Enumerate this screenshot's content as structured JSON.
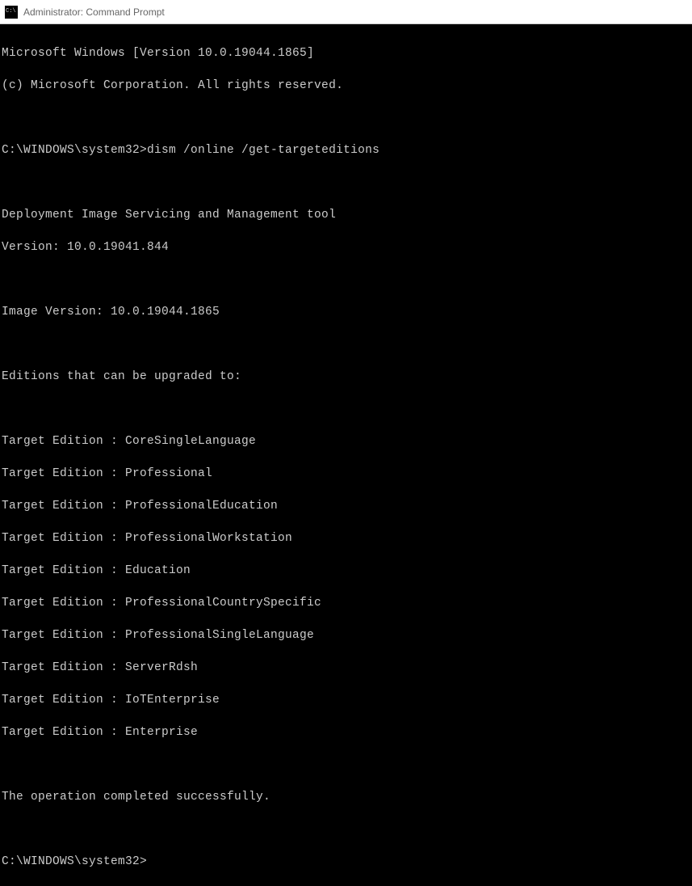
{
  "titlebar": {
    "text": "Administrator: Command Prompt"
  },
  "terminal": {
    "banner_line1": "Microsoft Windows [Version 10.0.19044.1865]",
    "banner_line2": "(c) Microsoft Corporation. All rights reserved.",
    "prompt1_path": "C:\\WINDOWS\\system32>",
    "prompt1_command": "dism /online /get-targeteditions",
    "tool_name": "Deployment Image Servicing and Management tool",
    "tool_version": "Version: 10.0.19041.844",
    "image_version": "Image Version: 10.0.19044.1865",
    "editions_header": "Editions that can be upgraded to:",
    "editions": [
      "Target Edition : CoreSingleLanguage",
      "Target Edition : Professional",
      "Target Edition : ProfessionalEducation",
      "Target Edition : ProfessionalWorkstation",
      "Target Edition : Education",
      "Target Edition : ProfessionalCountrySpecific",
      "Target Edition : ProfessionalSingleLanguage",
      "Target Edition : ServerRdsh",
      "Target Edition : IoTEnterprise",
      "Target Edition : Enterprise"
    ],
    "completion": "The operation completed successfully.",
    "prompt2_path": "C:\\WINDOWS\\system32>"
  }
}
